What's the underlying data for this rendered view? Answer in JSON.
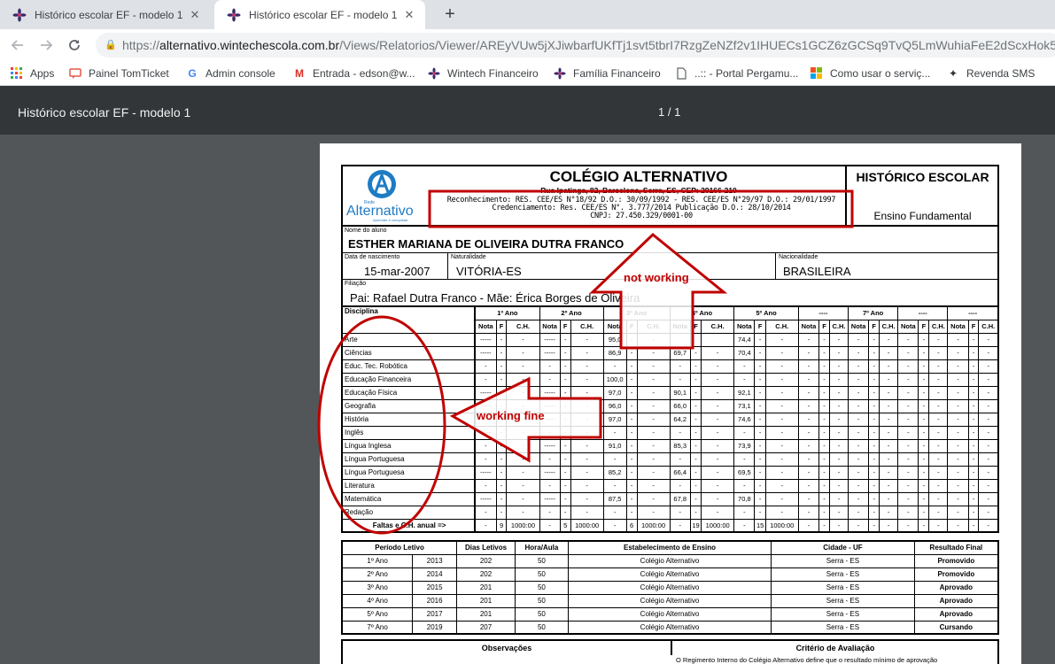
{
  "tabs": [
    {
      "title": "Histórico escolar EF - modelo 1",
      "close": "✕"
    },
    {
      "title": "Histórico escolar EF - modelo 1",
      "close": "✕"
    }
  ],
  "new_tab": "+",
  "address": {
    "prefix": "https://",
    "host": "alternativo.wintechescola.com.br",
    "path": "/Views/Relatorios/Viewer/AREyVUw5jXJiwbarfUKfTj1svt5tbrI7RzgZeNZf2v1IHUECs1GCZ6zGCSq9TvQ5LmWuhiaFeE2dScxHok5wjp8k"
  },
  "bookmarks": [
    "Apps",
    "Painel TomTicket",
    "Admin console",
    "Entrada - edson@w...",
    "Wintech Financeiro",
    "Família Financeiro",
    "..:: - Portal Pergamu...",
    "Como usar o serviç...",
    "Revenda SMS"
  ],
  "pdf": {
    "title": "Histórico escolar EF - modelo 1",
    "page": "1 / 1"
  },
  "doc": {
    "school": "COLÉGIO ALTERNATIVO",
    "address": "Rua Ipatinga, 82, Barcelona, Serra, ES, CEP: 29166-210",
    "recog1": "Reconhecimento: RES. CEE/ES N°18/92 D.O.: 30/09/1992 - RES. CEE/ES N°29/97 D.O.: 29/01/1997",
    "recog2": "Credenciamento: Res. CEE/ES N°. 3.777/2014 Publicação D.O.: 28/10/2014",
    "cnpj": "CNPJ: 27.450.329/0001-00",
    "logo_text": "Alternativo",
    "logo_rede": "Rede",
    "logo_tag": "Aprender é conquistar",
    "hist_title": "HISTÓRICO ESCOLAR",
    "hist_sub": "Ensino Fundamental",
    "name_label": "Nome do aluno",
    "name": "ESTHER MARIANA DE OLIVEIRA DUTRA FRANCO",
    "dob_label": "Data de nascimento",
    "dob": "15-mar-2007",
    "nat_label": "Naturalidade",
    "nat": "VITÓRIA-ES",
    "nac_label": "Nacionalidade",
    "nac": "BRASILEIRA",
    "fil_label": "Filiação",
    "fil": "Pai: Rafael Dutra Franco - Mãe: Érica Borges de Oliveira"
  },
  "grades": {
    "subject_header": "Disciplina",
    "years": [
      "1º Ano",
      "2º Ano",
      "3º Ano",
      "4º Ano",
      "5º Ano",
      "----",
      "7º Ano",
      "----",
      "----"
    ],
    "subcols": [
      "Nota",
      "F",
      "C.H."
    ],
    "rows": [
      {
        "subject": "Arte",
        "cells": [
          "-----",
          "-",
          "-",
          "-----",
          "-",
          "-",
          "95,0",
          "-",
          "-",
          "",
          "",
          "",
          "74,4",
          "-",
          "-",
          "-",
          "-",
          "-",
          "-",
          "-",
          "-",
          "-",
          "-",
          "-",
          "-",
          "-",
          "-"
        ]
      },
      {
        "subject": "Ciências",
        "cells": [
          "-----",
          "-",
          "-",
          "-----",
          "-",
          "-",
          "86,9",
          "-",
          "-",
          "69,7",
          "-",
          "-",
          "70,4",
          "-",
          "-",
          "-",
          "-",
          "-",
          "-",
          "-",
          "-",
          "-",
          "-",
          "-",
          "-",
          "-",
          "-"
        ]
      },
      {
        "subject": "Educ. Tec. Robótica",
        "cells": [
          "-",
          "-",
          "-",
          "-",
          "-",
          "-",
          "-",
          "-",
          "-",
          "-",
          "-",
          "-",
          "-",
          "-",
          "-",
          "-",
          "-",
          "-",
          "-",
          "-",
          "-",
          "-",
          "-",
          "-",
          "-",
          "-",
          "-"
        ]
      },
      {
        "subject": "Educação Financeira",
        "cells": [
          "-",
          "-",
          "-",
          "-",
          "-",
          "-",
          "100,0",
          "-",
          "-",
          "-",
          "-",
          "-",
          "-",
          "-",
          "-",
          "-",
          "-",
          "-",
          "-",
          "-",
          "-",
          "-",
          "-",
          "-",
          "-",
          "-",
          "-"
        ]
      },
      {
        "subject": "Educação Física",
        "cells": [
          "-----",
          "-",
          "-",
          "-----",
          "-",
          "-",
          "97,0",
          "-",
          "-",
          "90,1",
          "-",
          "-",
          "92,1",
          "-",
          "-",
          "-",
          "-",
          "-",
          "-",
          "-",
          "-",
          "-",
          "-",
          "-",
          "-",
          "-",
          "-"
        ]
      },
      {
        "subject": "Geografia",
        "cells": [
          "-----",
          "-",
          "-",
          "-----",
          "-",
          "-",
          "96,0",
          "-",
          "-",
          "66,0",
          "-",
          "-",
          "73,1",
          "-",
          "-",
          "-",
          "-",
          "-",
          "-",
          "-",
          "-",
          "-",
          "-",
          "-",
          "-",
          "-",
          "-"
        ]
      },
      {
        "subject": "História",
        "cells": [
          "-----",
          "-",
          "-",
          "-----",
          "-",
          "-",
          "97,0",
          "-",
          "-",
          "64,2",
          "-",
          "-",
          "74,6",
          "-",
          "-",
          "-",
          "-",
          "-",
          "-",
          "-",
          "-",
          "-",
          "-",
          "-",
          "-",
          "-",
          "-"
        ]
      },
      {
        "subject": "Inglês",
        "cells": [
          "-----",
          "-",
          "-",
          "-",
          "-",
          "-",
          "-",
          "-",
          "-",
          "-",
          "-",
          "-",
          "-",
          "-",
          "-",
          "-",
          "-",
          "-",
          "-",
          "-",
          "-",
          "-",
          "-",
          "-",
          "-",
          "-",
          "-"
        ]
      },
      {
        "subject": "Língua Inglesa",
        "cells": [
          "-",
          "-",
          "-",
          "-----",
          "-",
          "-",
          "91,0",
          "-",
          "-",
          "85,3",
          "-",
          "-",
          "73,9",
          "-",
          "-",
          "-",
          "-",
          "-",
          "-",
          "-",
          "-",
          "-",
          "-",
          "-",
          "-",
          "-",
          "-"
        ]
      },
      {
        "subject": "Língua Portuguesa",
        "cells": [
          "-",
          "-",
          "-",
          "-",
          "-",
          "-",
          "-",
          "-",
          "-",
          "-",
          "-",
          "-",
          "-",
          "-",
          "-",
          "-",
          "-",
          "-",
          "-",
          "-",
          "-",
          "-",
          "-",
          "-",
          "-",
          "-",
          "-"
        ]
      },
      {
        "subject": "Língua Portuguesa",
        "cells": [
          "-----",
          "-",
          "-",
          "-----",
          "-",
          "-",
          "85,2",
          "-",
          "-",
          "66,4",
          "-",
          "-",
          "69,5",
          "-",
          "-",
          "-",
          "-",
          "-",
          "-",
          "-",
          "-",
          "-",
          "-",
          "-",
          "-",
          "-",
          "-"
        ]
      },
      {
        "subject": "Literatura",
        "cells": [
          "-",
          "-",
          "-",
          "-",
          "-",
          "-",
          "-",
          "-",
          "-",
          "-",
          "-",
          "-",
          "-",
          "-",
          "-",
          "-",
          "-",
          "-",
          "-",
          "-",
          "-",
          "-",
          "-",
          "-",
          "-",
          "-",
          "-"
        ]
      },
      {
        "subject": "Matemática",
        "cells": [
          "-----",
          "-",
          "-",
          "-----",
          "-",
          "-",
          "87,5",
          "-",
          "-",
          "67,8",
          "-",
          "-",
          "70,8",
          "-",
          "-",
          "-",
          "-",
          "-",
          "-",
          "-",
          "-",
          "-",
          "-",
          "-",
          "-",
          "-",
          "-"
        ]
      },
      {
        "subject": "Redação",
        "cells": [
          "-",
          "-",
          "-",
          "-",
          "-",
          "-",
          "-",
          "-",
          "-",
          "-",
          "-",
          "-",
          "-",
          "-",
          "-",
          "-",
          "-",
          "-",
          "-",
          "-",
          "-",
          "-",
          "-",
          "-",
          "-",
          "-",
          "-"
        ]
      }
    ],
    "total_label": "Faltas e C.H. anual =>",
    "total_cells": [
      "-",
      "9",
      "1000:00",
      "-",
      "5",
      "1000:00",
      "-",
      "6",
      "1000:00",
      "-",
      "19",
      "1000:00",
      "-",
      "15",
      "1000:00",
      "-",
      "-",
      "-",
      "-",
      "-",
      "-",
      "-",
      "-",
      "-",
      "-",
      "-",
      "-"
    ]
  },
  "periods": {
    "headers": [
      "Período Letivo",
      "Dias Letivos",
      "Hora/Aula",
      "Estabelecimento de Ensino",
      "Cidade - UF",
      "Resultado Final"
    ],
    "rows": [
      [
        "1º Ano",
        "2013",
        "202",
        "50",
        "Colégio Alternativo",
        "Serra - ES",
        "Promovido"
      ],
      [
        "2º Ano",
        "2014",
        "202",
        "50",
        "Colégio Alternativo",
        "Serra - ES",
        "Promovido"
      ],
      [
        "3º Ano",
        "2015",
        "201",
        "50",
        "Colégio Alternativo",
        "Serra - ES",
        "Aprovado"
      ],
      [
        "4º Ano",
        "2016",
        "201",
        "50",
        "Colégio Alternativo",
        "Serra - ES",
        "Aprovado"
      ],
      [
        "5º Ano",
        "2017",
        "201",
        "50",
        "Colégio Alternativo",
        "Serra - ES",
        "Aprovado"
      ],
      [
        "7º Ano",
        "2019",
        "207",
        "50",
        "Colégio Alternativo",
        "Serra - ES",
        "Cursando"
      ]
    ]
  },
  "obs": {
    "title": "Observações",
    "crit_title": "Critério de Avaliação",
    "crit_text": "O Regimento Interno do Colégio Alternativo define que o resultado mínimo de aprovação"
  },
  "annotations": {
    "not_working": "not working",
    "working_fine": "working fine"
  },
  "colors": {
    "annotation": "#c00000",
    "tabstrip": "#dee1e6",
    "pdf_toolbar": "#323639",
    "viewer_bg": "#525659"
  }
}
